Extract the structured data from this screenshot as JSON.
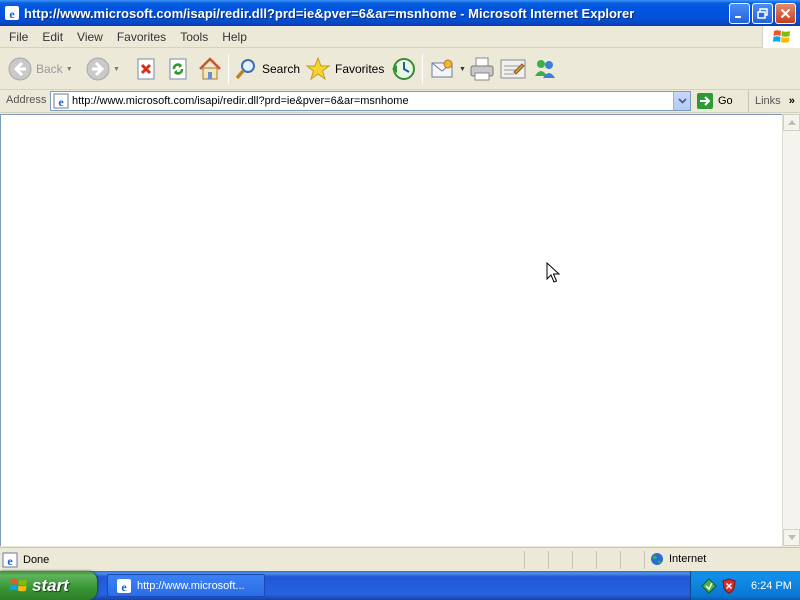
{
  "window": {
    "title": "http://www.microsoft.com/isapi/redir.dll?prd=ie&pver=6&ar=msnhome - Microsoft Internet Explorer"
  },
  "menu": [
    "File",
    "Edit",
    "View",
    "Favorites",
    "Tools",
    "Help"
  ],
  "toolbar": {
    "back_label": "Back",
    "search_label": "Search",
    "favorites_label": "Favorites"
  },
  "address": {
    "label": "Address",
    "url": "http://www.microsoft.com/isapi/redir.dll?prd=ie&pver=6&ar=msnhome",
    "go_label": "Go",
    "links_label": "Links"
  },
  "status": {
    "text": "Done",
    "zone": "Internet"
  },
  "taskbar": {
    "start_label": "start",
    "task_label": "http://www.microsoft...",
    "clock": "6:24 PM"
  },
  "colors": {
    "titlebar": "#0054e3",
    "taskbar": "#245edb",
    "start": "#3c8f3a",
    "tray": "#0c8ae3"
  }
}
